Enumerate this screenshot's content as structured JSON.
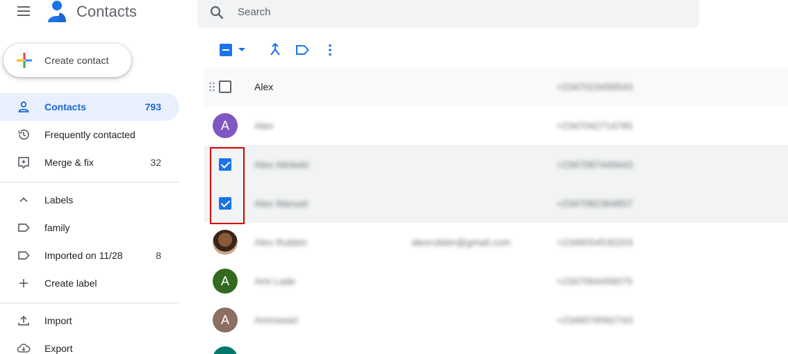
{
  "header": {
    "title": "Contacts",
    "search_placeholder": "Search",
    "icons": [
      "menu-icon",
      "contacts-logo-icon",
      "search-icon"
    ]
  },
  "sidebar": {
    "create_label": "Create contact",
    "items": [
      {
        "label": "Contacts",
        "count": "793",
        "icon": "person-icon",
        "active": true
      },
      {
        "label": "Frequently contacted",
        "count": "",
        "icon": "history-icon"
      },
      {
        "label": "Merge & fix",
        "count": "32",
        "icon": "merge-fix-icon"
      }
    ],
    "labels_header": "Labels",
    "labels": [
      {
        "label": "family",
        "count": ""
      },
      {
        "label": "Imported on 11/28",
        "count": "8"
      }
    ],
    "create_label_text": "Create label",
    "import_label": "Import",
    "export_label": "Export"
  },
  "toolbar": {
    "icons": [
      "select-all-checkbox",
      "dropdown-caret-icon",
      "merge-icon",
      "label-icon",
      "more-vert-icon"
    ]
  },
  "contacts": [
    {
      "name": "Alex",
      "email": "",
      "phone": "+2347023456543",
      "avatar": "",
      "checked": false,
      "hover": true
    },
    {
      "name": "Alex",
      "email": "",
      "phone": "+2347042714785",
      "avatar": "A",
      "checked": false
    },
    {
      "name": "Alex Alinkeki",
      "email": "",
      "phone": "+2347087449443",
      "avatar": "",
      "checked": true
    },
    {
      "name": "Alex Manuel",
      "email": "",
      "phone": "+2347082364857",
      "avatar": "",
      "checked": true
    },
    {
      "name": "Alex Rubbin",
      "email": "alexrubbin@gmail.com",
      "phone": "+2348054530203",
      "avatar": "photo",
      "checked": false
    },
    {
      "name": "Ami Lade",
      "email": "",
      "phone": "+2347064456075",
      "avatar": "A",
      "checked": false
    },
    {
      "name": "Ammasari",
      "email": "",
      "phone": "+2348076562743",
      "avatar": "A",
      "checked": false
    }
  ],
  "colors": {
    "accent": "#1a73e8",
    "active_bg": "#e8f0fe",
    "avatar_purple": "#7e57c2",
    "avatar_green": "#33691e",
    "avatar_brown": "#8d6e63",
    "avatar_teal": "#00796b",
    "highlight": "#d50000"
  }
}
